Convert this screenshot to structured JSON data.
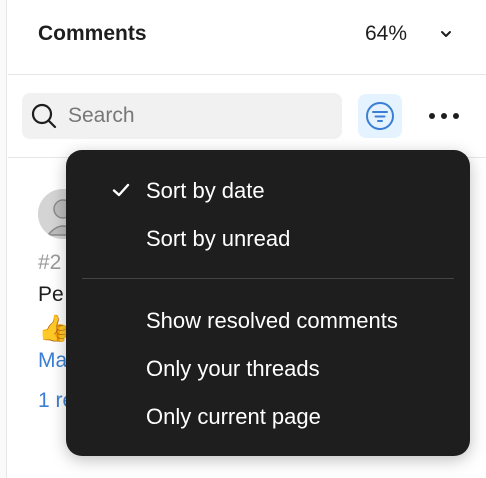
{
  "header": {
    "title": "Comments",
    "zoom": "64%"
  },
  "toolbar": {
    "search_placeholder": "Search"
  },
  "comment": {
    "number": "#2",
    "text": "Pe",
    "emoji": "👍",
    "link": "Ma",
    "replies": "1 re"
  },
  "menu": {
    "sort_items": [
      {
        "label": "Sort by date",
        "checked": true
      },
      {
        "label": "Sort by unread",
        "checked": false
      }
    ],
    "filter_items": [
      {
        "label": "Show resolved comments"
      },
      {
        "label": "Only your threads"
      },
      {
        "label": "Only current page"
      }
    ]
  },
  "colors": {
    "accent": "#3a7fd5",
    "filter_active_bg": "#e5f2ff",
    "menu_bg": "#1e1e1e"
  },
  "icons": [
    "chevron-down-icon",
    "search-icon",
    "filter-icon",
    "more-icon",
    "check-icon"
  ]
}
